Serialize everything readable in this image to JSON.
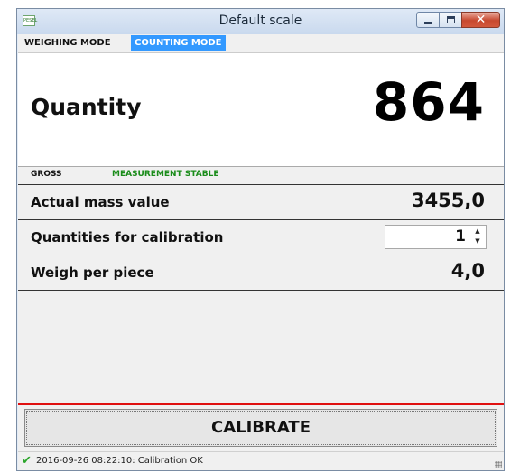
{
  "window": {
    "title": "Default scale",
    "app_icon_text": "PESEL",
    "close_glyph": "✕"
  },
  "tabs": [
    {
      "label": "WEIGHING MODE",
      "active": false
    },
    {
      "label": "COUNTING MODE",
      "active": true
    }
  ],
  "quantity": {
    "label": "Quantity",
    "value": "864"
  },
  "status": {
    "gross": "GROSS",
    "stability": "MEASUREMENT STABLE"
  },
  "rows": {
    "actual_mass": {
      "label": "Actual mass value",
      "value": "3455,0"
    },
    "calibration_qty": {
      "label": "Quantities for calibration",
      "value": "1"
    },
    "weigh_per_piece": {
      "label": "Weigh per piece",
      "value": "4,0"
    }
  },
  "spinner": {
    "up": "▲",
    "down": "▼"
  },
  "calibrate_label": "CALIBRATE",
  "statusbar": {
    "icon": "✔",
    "text": "2016-09-26 08:22:10: Calibration OK"
  },
  "colors": {
    "active_tab": "#3399ff",
    "stable_text": "#1a8c1a",
    "separator_red": "#e01010",
    "close_button": "#c7482f"
  }
}
